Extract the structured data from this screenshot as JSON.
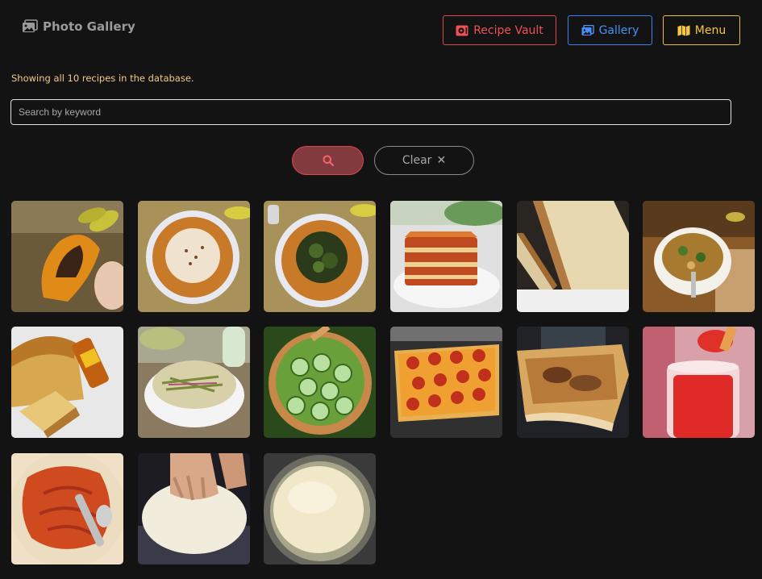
{
  "brand": {
    "title": "Photo Gallery",
    "icon": "images-icon"
  },
  "nav": {
    "vault_label": "Recipe Vault",
    "gallery_label": "Gallery",
    "menu_label": "Menu"
  },
  "status_text": "Showing all 10 recipes in the database.",
  "search": {
    "placeholder": "Search by keyword",
    "value": ""
  },
  "actions": {
    "search_icon": "search-icon",
    "clear_label": "Clear"
  },
  "colors": {
    "background": "#131313",
    "vault": "#e0454b",
    "gallery": "#3b82f0",
    "menu": "#f0c030",
    "status": "#f5c88a"
  },
  "photos": [
    "cheese-taco",
    "bowl-cream-topping",
    "bowl-greens-topping",
    "lasagna",
    "sourdough-bread",
    "vegetable-soup",
    "beer-bread",
    "coleslaw",
    "cucumber-salad",
    "pepperoni-pizza",
    "cheese-bread-pizza",
    "tomato-sauce-jar",
    "pizza-dough-sauce",
    "kneading-dough",
    "risen-dough"
  ]
}
